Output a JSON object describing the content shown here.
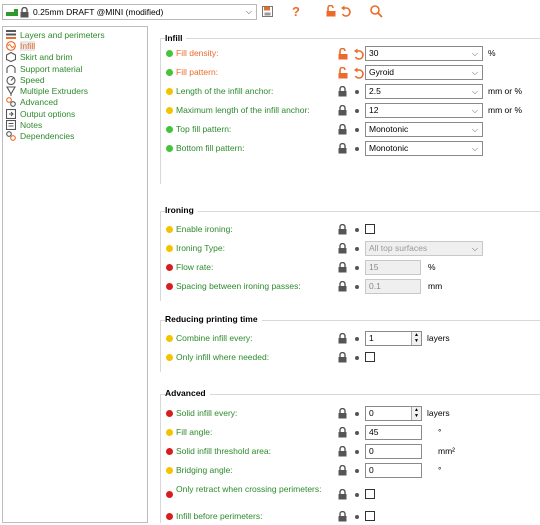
{
  "toolbar": {
    "preset_name": "0.25mm DRAFT @MINI (modified)",
    "help_label": "?",
    "colors": {
      "green": "#2d9a2d",
      "orange": "#ea6b2a"
    },
    "icons": [
      "printer-icon",
      "lock-icon",
      "save-icon",
      "question-icon",
      "unlock-icon",
      "undo-icon",
      "search-icon"
    ]
  },
  "sidebar": {
    "items": [
      {
        "label": "Layers and perimeters",
        "icon": "layers-icon"
      },
      {
        "label": "Infill",
        "icon": "infill-icon",
        "active": true
      },
      {
        "label": "Skirt and brim",
        "icon": "skirt-icon"
      },
      {
        "label": "Support material",
        "icon": "support-icon"
      },
      {
        "label": "Speed",
        "icon": "speed-icon"
      },
      {
        "label": "Multiple Extruders",
        "icon": "extruders-icon"
      },
      {
        "label": "Advanced",
        "icon": "advanced-icon"
      },
      {
        "label": "Output options",
        "icon": "output-icon"
      },
      {
        "label": "Notes",
        "icon": "notes-icon"
      },
      {
        "label": "Dependencies",
        "icon": "dependencies-icon"
      }
    ]
  },
  "sections": {
    "infill": {
      "title": "Infill",
      "fill_density": {
        "label": "Fill density:",
        "value": "30",
        "unit": "%"
      },
      "fill_pattern": {
        "label": "Fill pattern:",
        "value": "Gyroid"
      },
      "anchor_length": {
        "label": "Length of the infill anchor:",
        "value": "2.5",
        "unit": "mm or %"
      },
      "anchor_max": {
        "label": "Maximum length of the infill anchor:",
        "value": "12",
        "unit": "mm or %"
      },
      "top_pattern": {
        "label": "Top fill pattern:",
        "value": "Monotonic"
      },
      "bottom_pattern": {
        "label": "Bottom fill pattern:",
        "value": "Monotonic"
      }
    },
    "ironing": {
      "title": "Ironing",
      "enable": {
        "label": "Enable ironing:"
      },
      "type": {
        "label": "Ironing Type:",
        "value": "All top surfaces"
      },
      "flow": {
        "label": "Flow rate:",
        "value": "15",
        "unit": "%"
      },
      "spacing": {
        "label": "Spacing between ironing passes:",
        "value": "0.1",
        "unit": "mm"
      }
    },
    "reducing": {
      "title": "Reducing printing time",
      "combine": {
        "label": "Combine infill every:",
        "value": "1",
        "unit": "layers"
      },
      "only_needed": {
        "label": "Only infill where needed:"
      }
    },
    "advanced": {
      "title": "Advanced",
      "solid_every": {
        "label": "Solid infill every:",
        "value": "0",
        "unit": "layers"
      },
      "fill_angle": {
        "label": "Fill angle:",
        "value": "45",
        "unit": "°"
      },
      "solid_threshold": {
        "label": "Solid infill threshold area:",
        "value": "0",
        "unit": "mm²"
      },
      "bridging_angle": {
        "label": "Bridging angle:",
        "value": "0",
        "unit": "°"
      },
      "retract_crossing": {
        "label": "Only retract when crossing perimeters:"
      },
      "before_perimeters": {
        "label": "Infill before perimeters:"
      }
    }
  },
  "dot_colors": {
    "green": "#43c43a",
    "yellow": "#f2c400",
    "red": "#d41f1f"
  }
}
